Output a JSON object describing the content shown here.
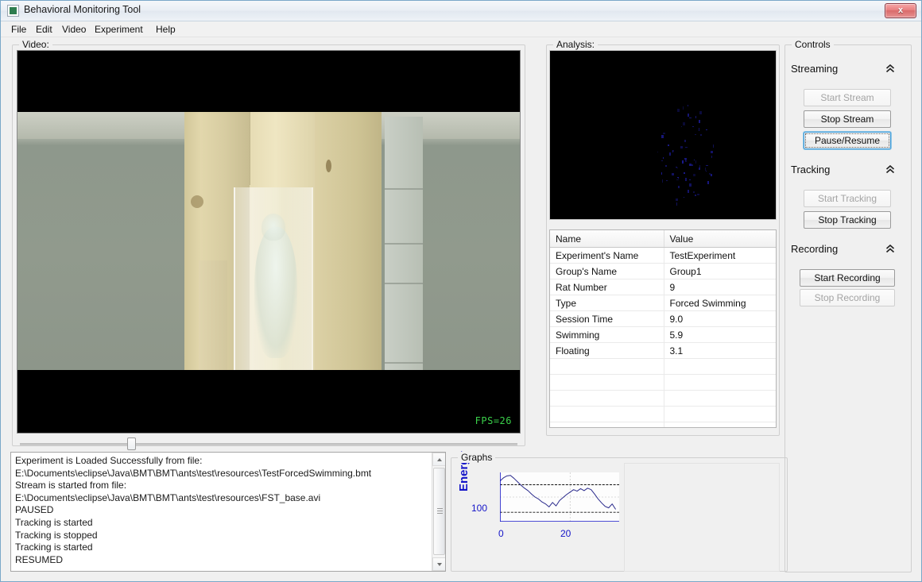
{
  "window": {
    "title": "Behavioral Monitoring Tool",
    "icon": "app-icon",
    "close_label": "x"
  },
  "menu": {
    "items": [
      {
        "label": "File"
      },
      {
        "label": "Edit"
      },
      {
        "label": "Video"
      },
      {
        "label": "Experiment"
      },
      {
        "label": "Help"
      }
    ]
  },
  "video": {
    "group_title": "Video:",
    "fps_overlay": "FPS=26",
    "slider_value": 22
  },
  "analysis": {
    "group_title": "Analysis:",
    "table": {
      "headers": [
        "Name",
        "Value"
      ],
      "rows": [
        [
          "Experiment's Name",
          "TestExperiment"
        ],
        [
          "Group's Name",
          "Group1"
        ],
        [
          "Rat Number",
          "9"
        ],
        [
          "Type",
          "Forced Swimming"
        ],
        [
          "Session Time",
          "9.0"
        ],
        [
          "Swimming",
          "5.9"
        ],
        [
          "Floating",
          "3.1"
        ],
        [
          "",
          ""
        ],
        [
          "",
          ""
        ],
        [
          "",
          ""
        ],
        [
          "",
          ""
        ],
        [
          "",
          ""
        ],
        [
          "",
          ""
        ],
        [
          "",
          ""
        ]
      ]
    }
  },
  "log": {
    "lines": [
      "Experiment is Loaded Successfully from file:",
      "E:\\Documents\\eclipse\\Java\\BMT\\BMT\\ants\\test\\resources\\TestForcedSwimming.bmt",
      "Stream is started from file:",
      "E:\\Documents\\eclipse\\Java\\BMT\\BMT\\ants\\test\\resources\\FST_base.avi",
      "PAUSED",
      "Tracking is started",
      "Tracking is stopped",
      "Tracking is started",
      "RESUMED"
    ]
  },
  "graphs": {
    "group_title": "Graphs"
  },
  "chart_data": {
    "type": "line",
    "title": "",
    "xlabel": "",
    "ylabel": "Energy",
    "series_color": "#2a2a8c",
    "axis_color": "#1414c8",
    "grid": true,
    "legend": "none",
    "xticks": [
      0,
      20
    ],
    "yticks": [
      100
    ],
    "xlim": [
      0,
      34
    ],
    "ylim": [
      0,
      200
    ],
    "threshold_lines": [
      150,
      38
    ],
    "x": [
      0,
      1,
      2,
      3,
      4,
      5,
      6,
      7,
      8,
      9,
      10,
      11,
      12,
      13,
      14,
      15,
      16,
      17,
      18,
      19,
      20,
      21,
      22,
      23,
      24,
      25,
      26,
      27,
      28,
      29,
      30,
      31,
      32,
      33
    ],
    "values": [
      165,
      178,
      186,
      188,
      176,
      162,
      148,
      136,
      126,
      112,
      100,
      92,
      80,
      72,
      60,
      78,
      64,
      86,
      98,
      110,
      120,
      130,
      124,
      134,
      126,
      136,
      130,
      112,
      92,
      76,
      62,
      56,
      72,
      50
    ]
  },
  "controls": {
    "group_title": "Controls",
    "sections": [
      {
        "title": "Streaming",
        "collapse_icon": "chevron-up-icon",
        "buttons": [
          {
            "label": "Start Stream",
            "state": "disabled"
          },
          {
            "label": "Stop Stream",
            "state": "enabled"
          },
          {
            "label": "Pause/Resume",
            "state": "focused"
          }
        ]
      },
      {
        "title": "Tracking",
        "collapse_icon": "chevron-up-icon",
        "buttons": [
          {
            "label": "Start Tracking",
            "state": "disabled"
          },
          {
            "label": "Stop Tracking",
            "state": "enabled"
          }
        ]
      },
      {
        "title": "Recording",
        "collapse_icon": "chevron-up-icon",
        "buttons": [
          {
            "label": "Start Recording",
            "state": "enabled"
          },
          {
            "label": "Stop Recording",
            "state": "disabled"
          }
        ]
      }
    ]
  }
}
